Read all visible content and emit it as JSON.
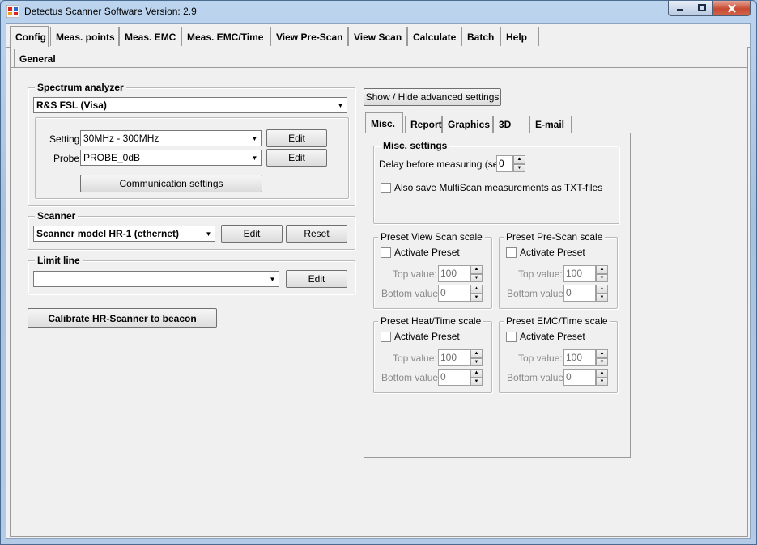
{
  "window": {
    "title": "Detectus Scanner Software Version: 2.9",
    "controls": {
      "minimize": "▁",
      "maximize": "□",
      "close": "✕"
    }
  },
  "main_tabs": [
    "Config",
    "Meas. points",
    "Meas. EMC",
    "Meas. EMC/Time",
    "View Pre-Scan",
    "View Scan",
    "Calculate",
    "Batch",
    "Help"
  ],
  "sub_tabs": [
    "General"
  ],
  "spectrum_analyzer": {
    "group_label": "Spectrum analyzer",
    "device": "R&S FSL (Visa)",
    "setting_label": "Setting:",
    "setting_value": "30MHz - 300MHz",
    "probe_label": "Probe:",
    "probe_value": "PROBE_0dB",
    "edit_label": "Edit",
    "comm_button": "Communication settings"
  },
  "scanner": {
    "group_label": "Scanner",
    "model": "Scanner model HR-1 (ethernet)",
    "edit_label": "Edit",
    "reset_label": "Reset"
  },
  "limit_line": {
    "group_label": "Limit line",
    "value": "",
    "edit_label": "Edit"
  },
  "calibrate_button": "Calibrate HR-Scanner to beacon",
  "advanced_button": "Show / Hide advanced settings",
  "adv_tabs": [
    "Misc.",
    "Report",
    "Graphics",
    "3D",
    "E-mail"
  ],
  "misc": {
    "group_label": "Misc. settings",
    "delay_label": "Delay before measuring (sec):",
    "delay_value": "0",
    "txt_label": "Also save MultiScan measurements as TXT-files"
  },
  "presets": [
    {
      "title": "Preset View Scan scale",
      "activate": "Activate Preset",
      "top_label": "Top value:",
      "top_value": "100",
      "bottom_label": "Bottom value:",
      "bottom_value": "0"
    },
    {
      "title": "Preset Pre-Scan scale",
      "activate": "Activate Preset",
      "top_label": "Top value:",
      "top_value": "100",
      "bottom_label": "Bottom value:",
      "bottom_value": "0"
    },
    {
      "title": "Preset Heat/Time scale",
      "activate": "Activate Preset",
      "top_label": "Top value:",
      "top_value": "100",
      "bottom_label": "Bottom value:",
      "bottom_value": "0"
    },
    {
      "title": "Preset EMC/Time scale",
      "activate": "Activate Preset",
      "top_label": "Top value:",
      "top_value": "100",
      "bottom_label": "Bottom value:",
      "bottom_value": "0"
    }
  ]
}
